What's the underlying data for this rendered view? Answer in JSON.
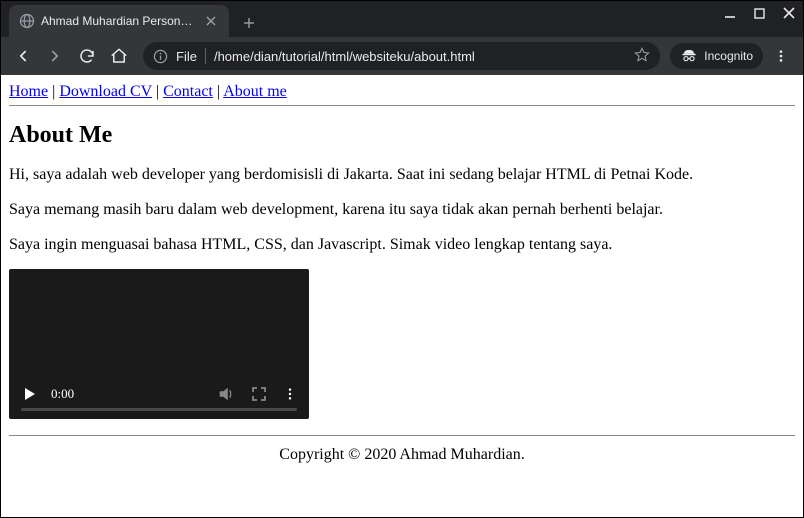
{
  "browser": {
    "tab_title": "Ahmad Muhardian Personal W",
    "file_label": "File",
    "url_path": "/home/dian/tutorial/html/websiteku/about.html",
    "incognito_label": "Incognito"
  },
  "page": {
    "nav": {
      "home": "Home",
      "download_cv": "Download CV",
      "contact": "Contact",
      "about_me": "About me",
      "sep": " | "
    },
    "heading": "About Me",
    "p1": "Hi, saya adalah web developer yang berdomisisli di Jakarta. Saat ini sedang belajar HTML di Petnai Kode.",
    "p2": "Saya memang masih baru dalam web development, karena itu saya tidak akan pernah berhenti belajar.",
    "p3": "Saya ingin menguasai bahasa HTML, CSS, dan Javascript. Simak video lengkap tentang saya.",
    "video_time": "0:00",
    "footer": "Copyright © 2020 Ahmad Muhardian."
  }
}
